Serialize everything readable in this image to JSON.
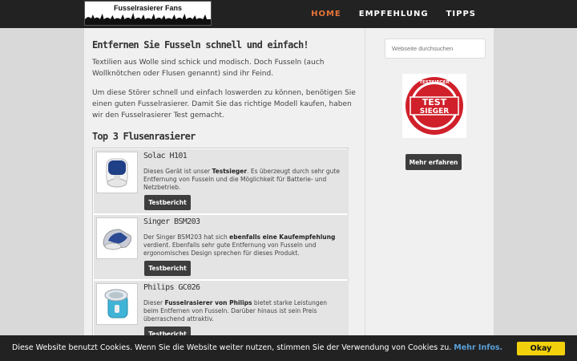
{
  "header": {
    "logo_text": "Fusselrasierer Fans",
    "nav": [
      {
        "label": "HOME",
        "active": true
      },
      {
        "label": "EMPFEHLUNG",
        "active": false
      },
      {
        "label": "TIPPS",
        "active": false
      }
    ]
  },
  "main": {
    "heading": "Entfernen Sie Fusseln schnell und einfach!",
    "para1": "Textilien aus Wolle sind schick und modisch. Doch Fusseln (auch Wollknötchen oder Flusen genannt) sind ihr Feind.",
    "para2": "Um diese Störer schnell und einfach loswerden zu können, benötigen Sie einen guten Fusselrasierer. Damit Sie das richtige Modell kaufen, haben wir den Fusselrasierer Test gemacht.",
    "subheading": "Top 3 Flusenrasierer",
    "products": [
      {
        "title": "Solac H101",
        "desc_pre": "Dieses Gerät ist unser ",
        "desc_bold": "Testsieger",
        "desc_post": ". Es überzeugt durch sehr gute Entfernung von Fusseln und die Möglichkeit für Batterie- und Netzbetrieb.",
        "button": "Testbericht",
        "image_icon": "lint-shaver-white-blue"
      },
      {
        "title": "Singer BSM203",
        "desc_pre": "Der Singer BSM203 hat sich ",
        "desc_bold": "ebenfalls eine Kaufempfehlung",
        "desc_post": " verdient. Ebenfalls sehr gute Entfernung von Fusseln und ergonomisches Design sprechen für dieses Produkt.",
        "button": "Testbericht",
        "image_icon": "lint-shaver-blue-grey"
      },
      {
        "title": "Philips GC026",
        "desc_pre": "Dieser ",
        "desc_bold": "Fusselrasierer von Philips",
        "desc_post": " bietet starke Leistungen beim Entfernen von Fusseln. Darüber hinaus ist sein Preis überraschend attraktiv.",
        "button": "Testbericht",
        "image_icon": "lint-shaver-teal"
      }
    ]
  },
  "sidebar": {
    "search_placeholder": "Webseite durchsuchen",
    "badge_text_top": "TEST",
    "badge_text_bottom": "SIEGER",
    "badge_ring_text": "TESTSIEGER",
    "more_button": "Mehr erfahren"
  },
  "cookie": {
    "text": "Diese Website benutzt Cookies. Wenn Sie die Website weiter nutzen, stimmen Sie der Verwendung von Cookies zu.",
    "link": "Mehr Infos.",
    "accept": "Okay"
  },
  "colors": {
    "topbar": "#222222",
    "nav_active": "#e8743b",
    "button": "#3d3d3d",
    "cookie_accept": "#f2d10c",
    "badge_red": "#d0202a"
  }
}
